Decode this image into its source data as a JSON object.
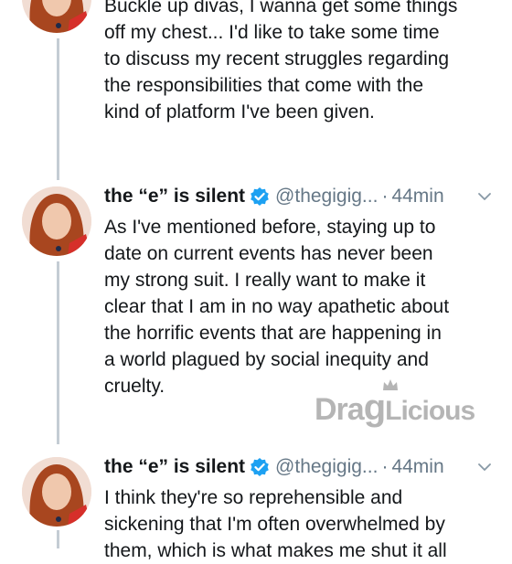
{
  "tweets": [
    {
      "body": "Buckle up divas, I wanna get some things\noff my chest... I'd like to take some time\nto discuss my recent struggles regarding\nthe responsibilities that come with the\nkind of platform I've been given."
    },
    {
      "name": "the “e” is silent",
      "handle": "@thegigig...",
      "sep": "·",
      "time": "44min",
      "body": "As I've mentioned before, staying up to\ndate on current events has never been\nmy strong suit. I really want to make it\nclear that I am in no way apathetic about\nthe horrific events that are happening in\na world plagued by social inequity and\ncruelty."
    },
    {
      "name": "the “e” is silent",
      "handle": "@thegigig...",
      "sep": "·",
      "time": "44min",
      "body": "I think they're so reprehensible and\nsickening that I'm often overwhelmed by\nthem, which is what makes me shut it all"
    }
  ],
  "icons": {
    "verified": "verified-badge-icon",
    "chevron": "chevron-down-icon"
  },
  "colors": {
    "verified_blue": "#1da1f2",
    "secondary_text": "#657786",
    "thread_line": "#c4ccd4"
  },
  "watermark": {
    "text": "DragLicious"
  }
}
